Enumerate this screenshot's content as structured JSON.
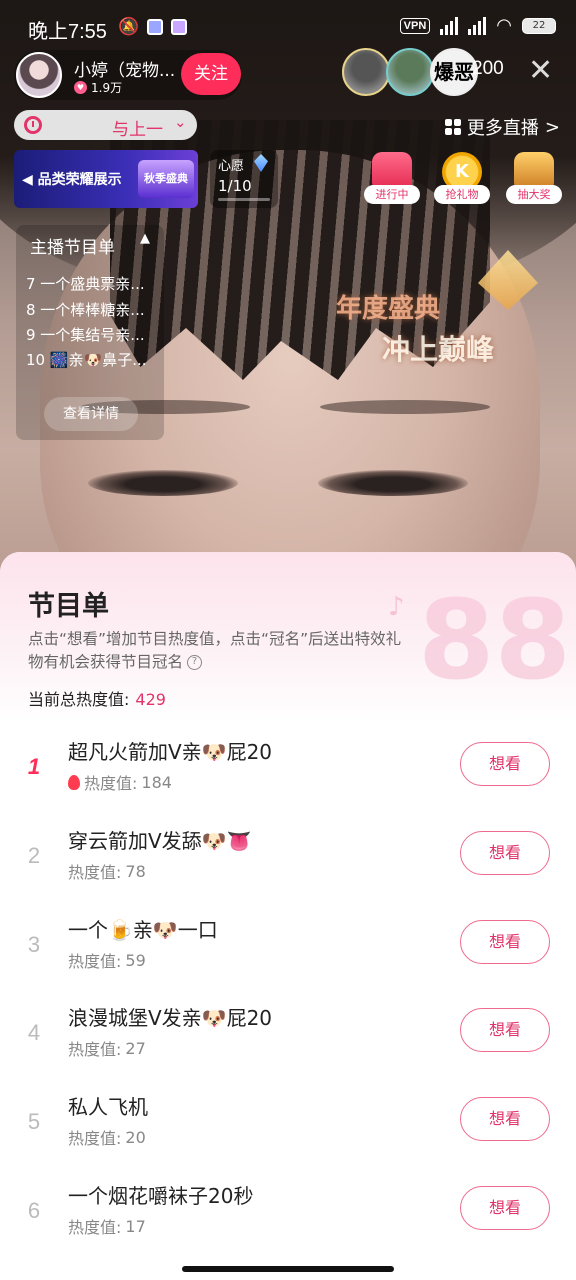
{
  "status_bar": {
    "time": "晚上7:55",
    "vpn": "VPN",
    "battery": "22"
  },
  "host": {
    "name": "小婷（宠物...",
    "fans": "1.9万",
    "follow_label": "关注"
  },
  "viewers": {
    "avatar3_text": "爆恶",
    "count": "200"
  },
  "rank_pill": {
    "label": "与上一"
  },
  "more_live": {
    "label": "更多直播",
    "chevron": ">"
  },
  "banner": {
    "text": "品类荣耀展示",
    "badge": "秋季盛典"
  },
  "wish": {
    "label": "心愿",
    "progress": "1/10"
  },
  "actions": [
    {
      "label": "进行中",
      "icon": "live-box-icon"
    },
    {
      "label": "抢礼物",
      "icon": "coin-icon",
      "glyph": "K"
    },
    {
      "label": "抽大奖",
      "icon": "treasure-chest-icon"
    }
  ],
  "schedule_overlay": {
    "title": "主播节目单",
    "items": [
      "7 一个盛典票亲...",
      "8 一个棒棒糖亲...",
      "9 一个集结号亲...",
      "10 🎆亲🐶鼻子..."
    ],
    "details_label": "查看详情"
  },
  "event_logo": {
    "line1": "年度盛典",
    "line2": "冲上巅峰"
  },
  "sheet": {
    "title": "节目单",
    "description": "点击“想看”增加节目热度值，点击“冠名”后送出特效礼物有机会获得节目冠名",
    "total_label": "当前总热度值:",
    "total_value": "429",
    "heat_label": "热度值:",
    "want_label": "想看",
    "deco": "88",
    "programs": [
      {
        "rank": "1",
        "title": "超凡火箭加V亲🐶屁20",
        "heat": "184"
      },
      {
        "rank": "2",
        "title": "穿云箭加V发舔🐶👅",
        "heat": "78"
      },
      {
        "rank": "3",
        "title": "一个🍺亲🐶一口",
        "heat": "59"
      },
      {
        "rank": "4",
        "title": "浪漫城堡V发亲🐶屁20",
        "heat": "27"
      },
      {
        "rank": "5",
        "title": "私人飞机",
        "heat": "20"
      },
      {
        "rank": "6",
        "title": "一个烟花嚼袜子20秒",
        "heat": "17"
      }
    ]
  },
  "colors": {
    "accent": "#e2336a",
    "follow": "#ff2d5a",
    "sheet_bg_top": "#fde3ec"
  }
}
